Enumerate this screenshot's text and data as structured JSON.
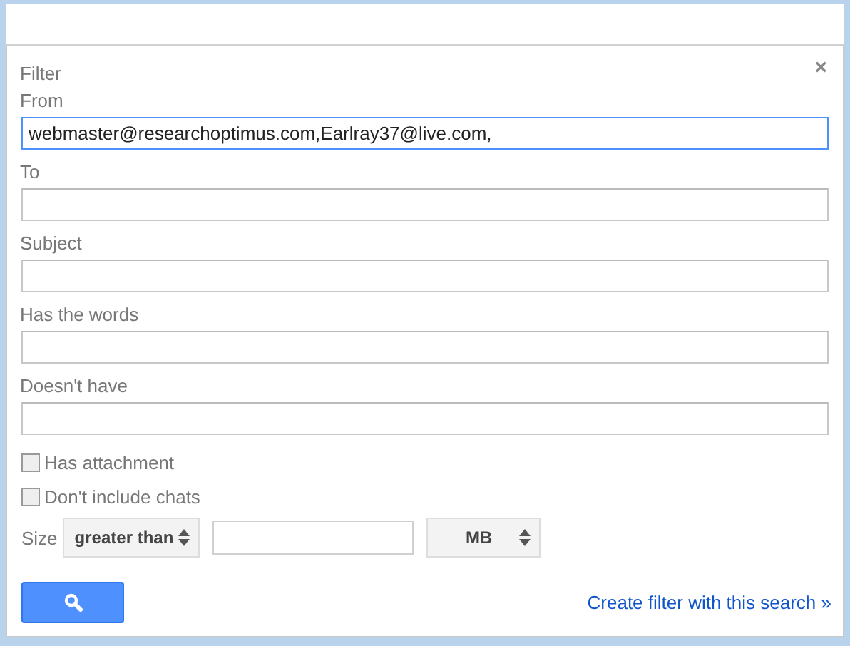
{
  "dialog": {
    "title": "Filter",
    "close": "×"
  },
  "fields": [
    {
      "label": "From",
      "value": "webmaster@researchoptimus.com,Earlray37@live.com,",
      "focused": true
    },
    {
      "label": "To",
      "focused": false
    },
    {
      "label": "Subject",
      "focused": false
    },
    {
      "label": "Has the words",
      "focused": false
    },
    {
      "label": "Doesn't have",
      "focused": false
    }
  ],
  "checkboxes": [
    {
      "label": "Has attachment",
      "checked": false
    },
    {
      "label": "Don't include chats",
      "checked": false
    }
  ],
  "size": {
    "label": "Size",
    "comparator": "greater than",
    "unit": "MB"
  },
  "create_filter_link": "Create filter with this search »"
}
